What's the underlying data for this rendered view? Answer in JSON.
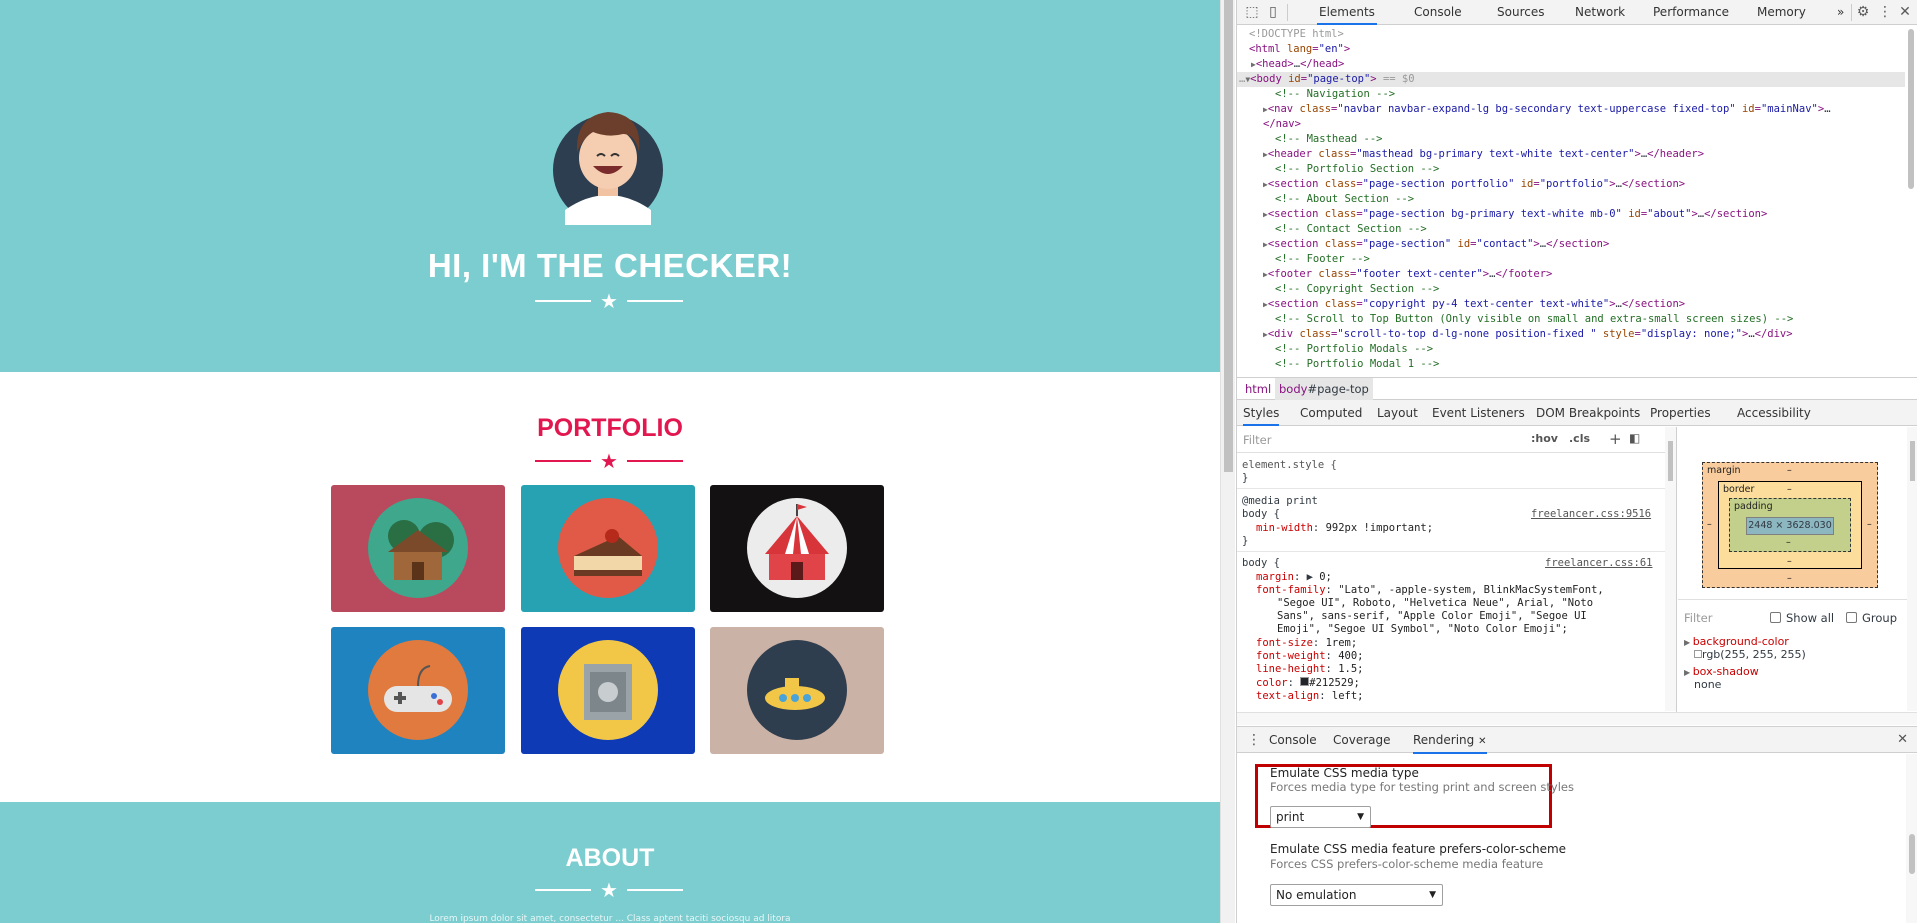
{
  "page": {
    "hero_title": "HI, I'M THE CHECKER!",
    "portfolio_title": "PORTFOLIO",
    "about_title": "ABOUT",
    "about_text": "Lorem ipsum dolor sit amet, consectetur ... Class aptent taciti sociosqu ad litora",
    "colors": {
      "masthead": "#7ccdd0",
      "portfolio_accent": "#e2174f"
    },
    "tiles": [
      {
        "name": "cabin",
        "bg": "#b94a5e"
      },
      {
        "name": "cake",
        "bg": "#26a2b3"
      },
      {
        "name": "circus",
        "bg": "#141112"
      },
      {
        "name": "game",
        "bg": "#1f83c0"
      },
      {
        "name": "safe",
        "bg": "#0e3ab5"
      },
      {
        "name": "submarine",
        "bg": "#cbb2a6"
      }
    ]
  },
  "devtools": {
    "tabs": [
      "Elements",
      "Console",
      "Sources",
      "Network",
      "Performance",
      "Memory"
    ],
    "more_tabs": "»",
    "dom": {
      "doctype": "<!DOCTYPE html>",
      "html_open": "<html lang=\"en\">",
      "head": "<head>…</head>",
      "body_sel": "== $0",
      "c_nav": "<!-- Navigation -->",
      "c_masthead": "<!-- Masthead -->",
      "c_portfolio": "<!-- Portfolio Section -->",
      "c_about": "<!-- About Section -->",
      "c_contact": "<!-- Contact Section -->",
      "c_footer": "<!-- Footer -->",
      "c_copyright": "<!-- Copyright Section -->",
      "c_scroll": "<!-- Scroll to Top Button (Only visible on small and extra-small screen sizes) -->",
      "c_modals": "<!-- Portfolio Modals -->",
      "c_modal1": "<!-- Portfolio Modal 1 -->",
      "nav_end": "</nav>"
    },
    "breadcrumb": [
      "html",
      "body",
      "#page-top"
    ],
    "subtabs": [
      "Styles",
      "Computed",
      "Layout",
      "Event Listeners",
      "DOM Breakpoints",
      "Properties",
      "Accessibility"
    ],
    "styles": {
      "filter_placeholder": "Filter",
      "hov": ":hov",
      "cls": ".cls",
      "element_style": "element.style {",
      "close_brace": "}",
      "media_print": "@media print",
      "body_sel": "body {",
      "minwidth_prop": "min-width",
      "minwidth_val": "992px !important;",
      "link1": "freelancer.css:9516",
      "link2": "freelancer.css:61",
      "margin_prop": "margin",
      "margin_val": "0;",
      "ff_prop": "font-family",
      "ff_val1": "\"Lato\", -apple-system, BlinkMacSystemFont,",
      "ff_val2": "\"Segoe UI\", Roboto, \"Helvetica Neue\", Arial, \"Noto",
      "ff_val3": "Sans\", sans-serif, \"Apple Color Emoji\", \"Segoe UI",
      "ff_val4": "Emoji\", \"Segoe UI Symbol\", \"Noto Color Emoji\";",
      "fs_prop": "font-size",
      "fs_val": "1rem;",
      "fw_prop": "font-weight",
      "fw_val": "400;",
      "lh_prop": "line-height",
      "lh_val": "1.5;",
      "color_prop": "color",
      "color_val": "#212529;",
      "ta_prop": "text-align",
      "ta_val": "left;"
    },
    "computed": {
      "margin_label": "margin",
      "border_label": "border",
      "padding_label": "padding",
      "dash": "–",
      "content_size": "2448 × 3628.030",
      "filter_placeholder": "Filter",
      "show_all": "Show all",
      "group": "Group",
      "bg_prop": "background-color",
      "bg_val": "rgb(255, 255, 255)",
      "shadow_prop": "box-shadow",
      "shadow_val": "none"
    },
    "drawer_tabs": [
      "Console",
      "Coverage",
      "Rendering"
    ],
    "rendering": {
      "media_title": "Emulate CSS media type",
      "media_sub": "Forces media type for testing print and screen styles",
      "media_value": "print",
      "scheme_title": "Emulate CSS media feature prefers-color-scheme",
      "scheme_sub": "Forces CSS prefers-color-scheme media feature",
      "scheme_value": "No emulation"
    }
  }
}
